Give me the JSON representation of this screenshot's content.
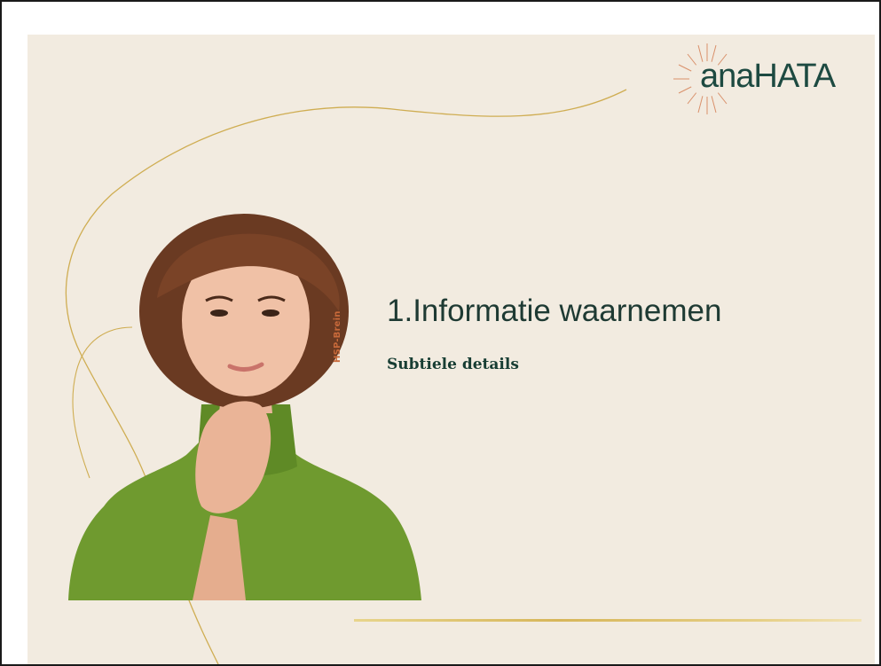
{
  "slide": {
    "title": "1.Informatie waarnemen",
    "subtitle": "Subtiele details",
    "side_label": "HSP-Brein",
    "logo_text": "anaHATA"
  },
  "colors": {
    "slide_background": "#f2ebe0",
    "title": "#1e3a33",
    "subtitle": "#173d33",
    "side_label": "#c8693a",
    "gold_accent": "#d7b65a",
    "logo_green": "#1d4a41",
    "logo_rays": "#d9906a",
    "sweater_green": "#6f9a2f"
  }
}
